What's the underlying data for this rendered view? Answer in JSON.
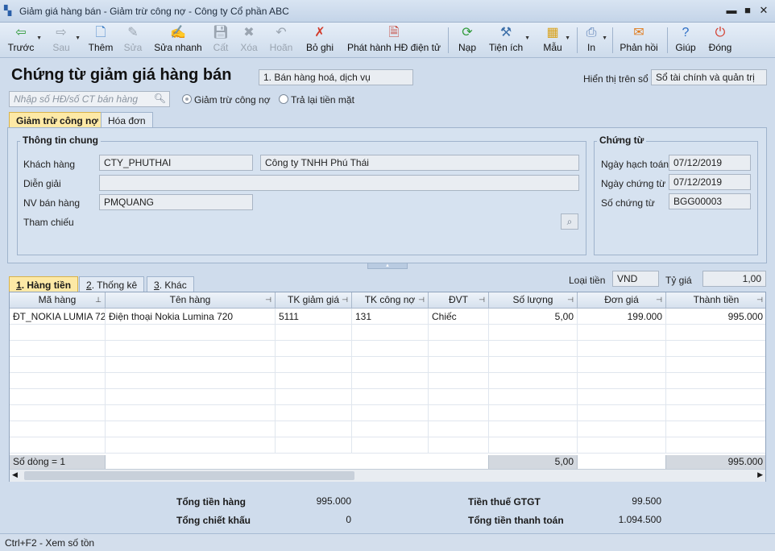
{
  "window": {
    "title": "Giảm giá hàng bán - Giảm trừ công nợ - Công ty Cổ phần ABC",
    "minimize": "▬",
    "maximize": "■",
    "close": "✕"
  },
  "toolbar": {
    "prev": "Trước",
    "next": "Sau",
    "add": "Thêm",
    "edit": "Sửa",
    "quick_edit": "Sửa nhanh",
    "save": "Cất",
    "delete": "Xóa",
    "undo": "Hoãn",
    "unpost": "Bỏ ghi",
    "issue_einvoice": "Phát hành HĐ điện tử",
    "load": "Nạp",
    "utilities": "Tiện ích",
    "template": "Mẫu",
    "print": "In",
    "feedback": "Phản hồi",
    "help": "Giúp",
    "close": "Đóng"
  },
  "header": {
    "title": "Chứng từ giảm giá hàng bán",
    "type_select": "1. Bán hàng hoá, dịch vụ",
    "display_label": "Hiển thị trên sổ",
    "display_value": "Sổ tài chính và quản trị"
  },
  "search": {
    "placeholder": "Nhập số HĐ/số CT bán hàng"
  },
  "options": {
    "opt1": "Giảm trừ công nợ",
    "opt2": "Trả lại tiền mặt"
  },
  "tabs": {
    "t1": "Giảm trừ công nợ",
    "t2": "Hóa đơn"
  },
  "general": {
    "title": "Thông tin chung",
    "customer_label": "Khách hàng",
    "customer_code": "CTY_PHUTHAI",
    "customer_name": "Công ty TNHH Phú Thái",
    "desc_label": "Diễn giải",
    "desc_value": "",
    "staff_label": "NV bán hàng",
    "staff_value": "PMQUANG",
    "ref_label": "Tham chiếu"
  },
  "voucher": {
    "title": "Chứng từ",
    "post_date_label": "Ngày hạch toán",
    "post_date": "07/12/2019",
    "doc_date_label": "Ngày chứng từ",
    "doc_date": "07/12/2019",
    "doc_no_label": "Số chứng từ",
    "doc_no": "BGG00003"
  },
  "detail_tabs": {
    "t1_key": "1",
    "t1": ". Hàng tiền",
    "t2_key": "2",
    "t2": ". Thống kê",
    "t3_key": "3",
    "t3": ". Khác"
  },
  "currency": {
    "label": "Loại tiền",
    "value": "VND",
    "rate_label": "Tỷ giá",
    "rate_value": "1,00"
  },
  "grid": {
    "columns": {
      "item_code": "Mã hàng",
      "item_name": "Tên hàng",
      "tk_discount": "TK giảm giá",
      "tk_debt": "TK công nợ",
      "unit": "ĐVT",
      "qty": "Số lượng",
      "price": "Đơn giá",
      "amount": "Thành tiền"
    },
    "row1": {
      "item_code": "ĐT_NOKIA LUMIA 72",
      "item_name": "Điện thoại Nokia Lumina 720",
      "tk_discount": "5111",
      "tk_debt": "131",
      "unit": "Chiếc",
      "qty": "5,00",
      "price": "199.000",
      "amount": "995.000"
    },
    "footer": {
      "rows": "Số dòng = 1",
      "qty": "5,00",
      "amount": "995.000"
    }
  },
  "totals": {
    "goods_label": "Tổng tiền hàng",
    "goods": "995.000",
    "discount_label": "Tổng chiết khấu",
    "discount": "0",
    "vat_label": "Tiền thuế GTGT",
    "vat": "99.500",
    "pay_label": "Tổng tiền thanh toán",
    "pay": "1.094.500"
  },
  "status": {
    "text": "Ctrl+F2 - Xem số tồn"
  }
}
